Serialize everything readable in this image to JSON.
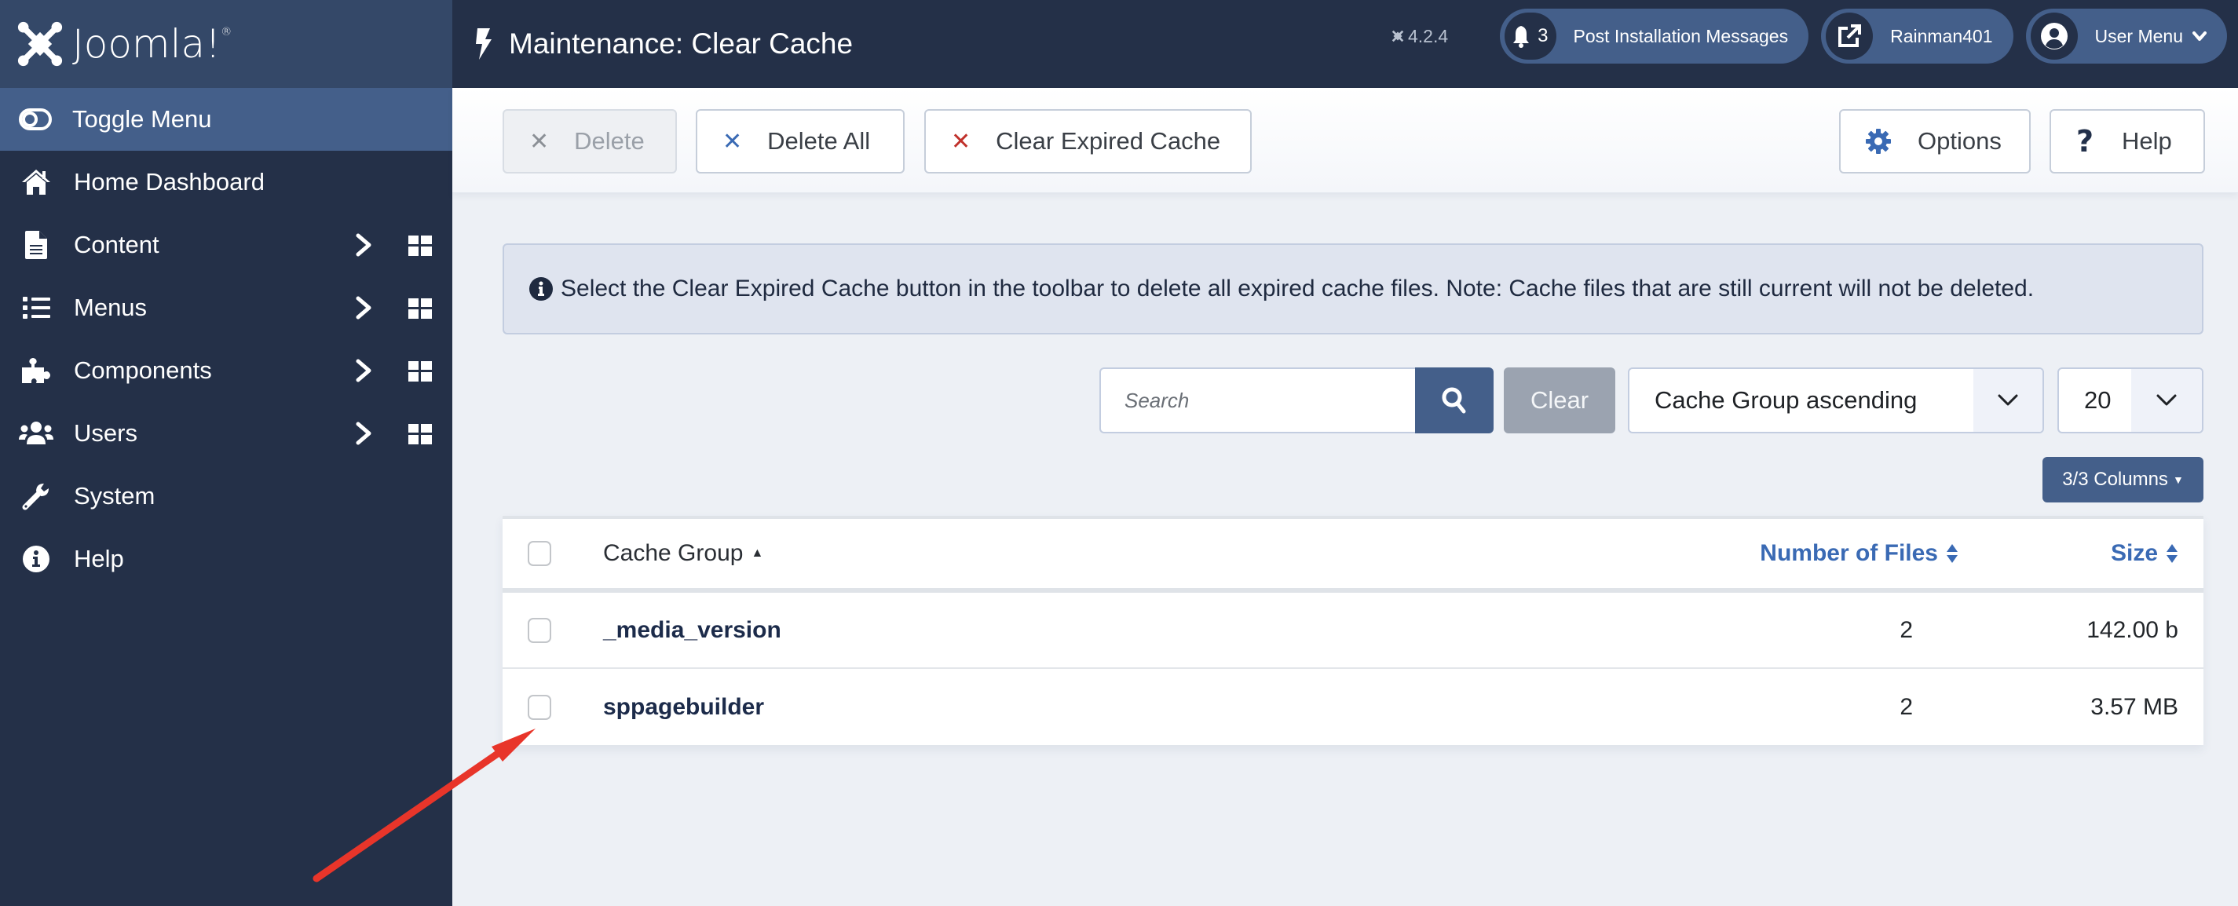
{
  "app": {
    "brand": "Joomla!",
    "version": "4.2.4"
  },
  "sidebar": {
    "toggle_label": "Toggle Menu",
    "items": [
      {
        "label": "Home Dashboard",
        "icon": "home-icon",
        "has_submenu": false
      },
      {
        "label": "Content",
        "icon": "file-icon",
        "has_submenu": true
      },
      {
        "label": "Menus",
        "icon": "list-icon",
        "has_submenu": true
      },
      {
        "label": "Components",
        "icon": "puzzle-icon",
        "has_submenu": true
      },
      {
        "label": "Users",
        "icon": "users-icon",
        "has_submenu": true
      },
      {
        "label": "System",
        "icon": "wrench-icon",
        "has_submenu": false
      },
      {
        "label": "Help",
        "icon": "info-icon",
        "has_submenu": false
      }
    ]
  },
  "header": {
    "title": "Maintenance: Clear Cache",
    "title_icon": "bolt-icon",
    "post_install": {
      "count": "3",
      "label": "Post Installation Messages"
    },
    "site_link": {
      "label": "Rainman401"
    },
    "user_menu": {
      "label": "User Menu"
    }
  },
  "toolbar": {
    "delete_label": "Delete",
    "delete_all_label": "Delete All",
    "clear_expired_label": "Clear Expired Cache",
    "options_label": "Options",
    "help_label": "Help"
  },
  "alert": {
    "message": "Select the Clear Expired Cache button in the toolbar to delete all expired cache files. Note: Cache files that are still current will not be deleted."
  },
  "filters": {
    "search_placeholder": "Search",
    "search_value": "",
    "clear_label": "Clear",
    "sort_value": "Cache Group ascending",
    "limit_value": "20",
    "columns_label": "3/3 Columns"
  },
  "table": {
    "columns": {
      "group": "Cache Group",
      "files": "Number of Files",
      "size": "Size"
    },
    "rows": [
      {
        "group": "_media_version",
        "files": "2",
        "size": "142.00 b"
      },
      {
        "group": "sppagebuilder",
        "files": "2",
        "size": "3.57 MB"
      }
    ]
  },
  "colors": {
    "sidebar_bg": "#243048",
    "header_bg": "#243048",
    "accent": "#445f8a",
    "link_blue": "#3a6ab4",
    "danger_red": "#c0312b",
    "annotation_arrow": "#e8352a"
  }
}
